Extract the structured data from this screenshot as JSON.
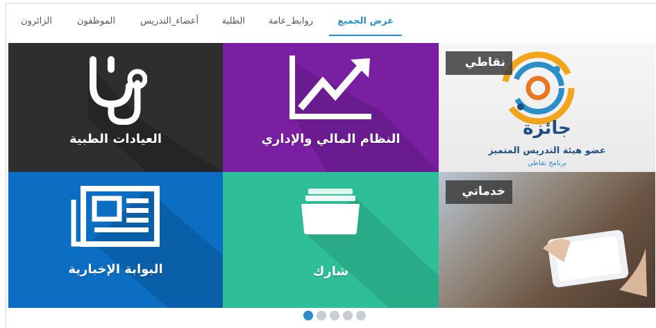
{
  "tabs": [
    {
      "label": "عرض الجميع",
      "active": true
    },
    {
      "label": "روابط_عامة",
      "active": false
    },
    {
      "label": "الطلبة",
      "active": false
    },
    {
      "label": "أعضاء_التدريس",
      "active": false
    },
    {
      "label": "الموظفون",
      "active": false
    },
    {
      "label": "الزائرون",
      "active": false
    }
  ],
  "tiles": {
    "medical": {
      "label": "العيادات الطبية",
      "color": "#2e2e2e",
      "icon": "stethoscope-icon"
    },
    "finance": {
      "label": "النظام المالي والإداري",
      "color": "#7b1fa2",
      "icon": "chart-trend-icon"
    },
    "points": {
      "tag": "نقاطي",
      "award_title": "جائزة",
      "award_subtitle": "عضو هيئة التدريس المتميز",
      "award_program": "برنامج نقاطي"
    },
    "news": {
      "label": "البوابة الإخبارية",
      "color": "#0c6ec3",
      "icon": "newspaper-icon"
    },
    "share": {
      "label": "شارك",
      "color": "#2fbf98",
      "icon": "folder-icon"
    },
    "services": {
      "tag": "خدماتي"
    }
  },
  "carousel": {
    "pages": 5,
    "active_page": 1
  },
  "colors": {
    "accent": "#2a8fc9",
    "tab_text": "#555555"
  }
}
